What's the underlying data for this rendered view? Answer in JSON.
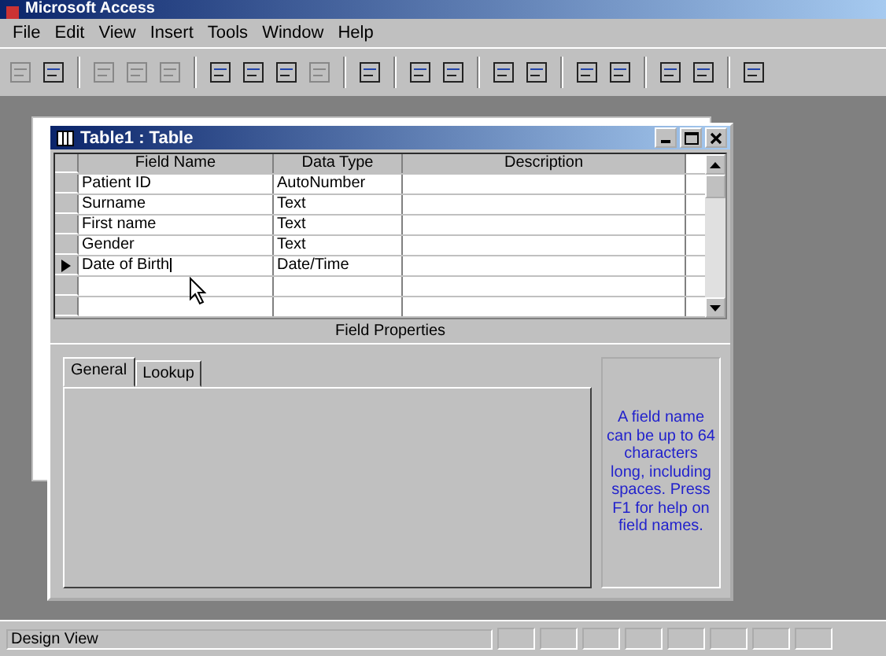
{
  "window": {
    "title": "Microsoft Access"
  },
  "menu": [
    {
      "label": "File"
    },
    {
      "label": "Edit"
    },
    {
      "label": "View"
    },
    {
      "label": "Insert"
    },
    {
      "label": "Tools"
    },
    {
      "label": "Window"
    },
    {
      "label": "Help"
    }
  ],
  "table_window": {
    "title": "Table1 : Table",
    "columns": [
      "Field Name",
      "Data Type",
      "Description"
    ],
    "rows": [
      {
        "field_name": "Patient ID",
        "data_type": "AutoNumber",
        "selected": false
      },
      {
        "field_name": "Surname",
        "data_type": "Text",
        "selected": false
      },
      {
        "field_name": "First name",
        "data_type": "Text",
        "selected": false
      },
      {
        "field_name": "Gender",
        "data_type": "Text",
        "selected": false
      },
      {
        "field_name": "Date of Birth",
        "data_type": "Date/Time",
        "selected": true
      }
    ],
    "field_properties": {
      "title": "Field Properties",
      "tabs": [
        {
          "label": "General",
          "selected": true
        },
        {
          "label": "Lookup",
          "selected": false
        }
      ],
      "help_text": "A field name can be up to 64 characters long, including spaces.  Press F1 for help on field names."
    }
  },
  "status_bar": {
    "text": "Design View"
  }
}
